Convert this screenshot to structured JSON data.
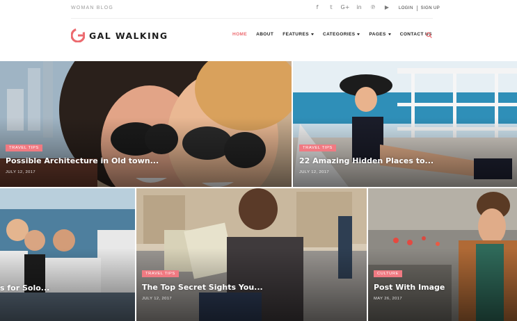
{
  "topbar": {
    "tagline": "WOMAN BLOG",
    "social_icons": [
      {
        "name": "facebook-icon",
        "glyph": "f"
      },
      {
        "name": "twitter-icon",
        "glyph": "𝕥"
      },
      {
        "name": "google-plus-icon",
        "glyph": "G+"
      },
      {
        "name": "linkedin-icon",
        "glyph": "in"
      },
      {
        "name": "pinterest-icon",
        "glyph": "℗"
      },
      {
        "name": "youtube-icon",
        "glyph": "▶"
      }
    ],
    "login": "LOGIN",
    "signup": "SIGN UP"
  },
  "header": {
    "logo_text": "GAL WALKING",
    "nav": {
      "home": "HOME",
      "about": "ABOUT",
      "features": "FEATURES",
      "categories": "CATEGORIES",
      "pages": "PAGES",
      "contact": "CONTACT US"
    }
  },
  "colors": {
    "accent": "#ec6a6f",
    "badge": "#f07a82"
  },
  "posts": [
    {
      "category": "TRAVEL TIPS",
      "title": "Possible Architecture in Old town...",
      "date": "JULY 12, 2017"
    },
    {
      "category": "TRAVEL TIPS",
      "title": "22 Amazing Hidden Places to...",
      "date": "JULY 12, 2017"
    },
    {
      "title": "s for Solo..."
    },
    {
      "category": "TRAVEL TIPS",
      "title": "The Top Secret Sights You...",
      "date": "JULY 12, 2017"
    },
    {
      "category": "CULTURE",
      "title": "Post With Image",
      "date": "MAY 26, 2017"
    }
  ]
}
